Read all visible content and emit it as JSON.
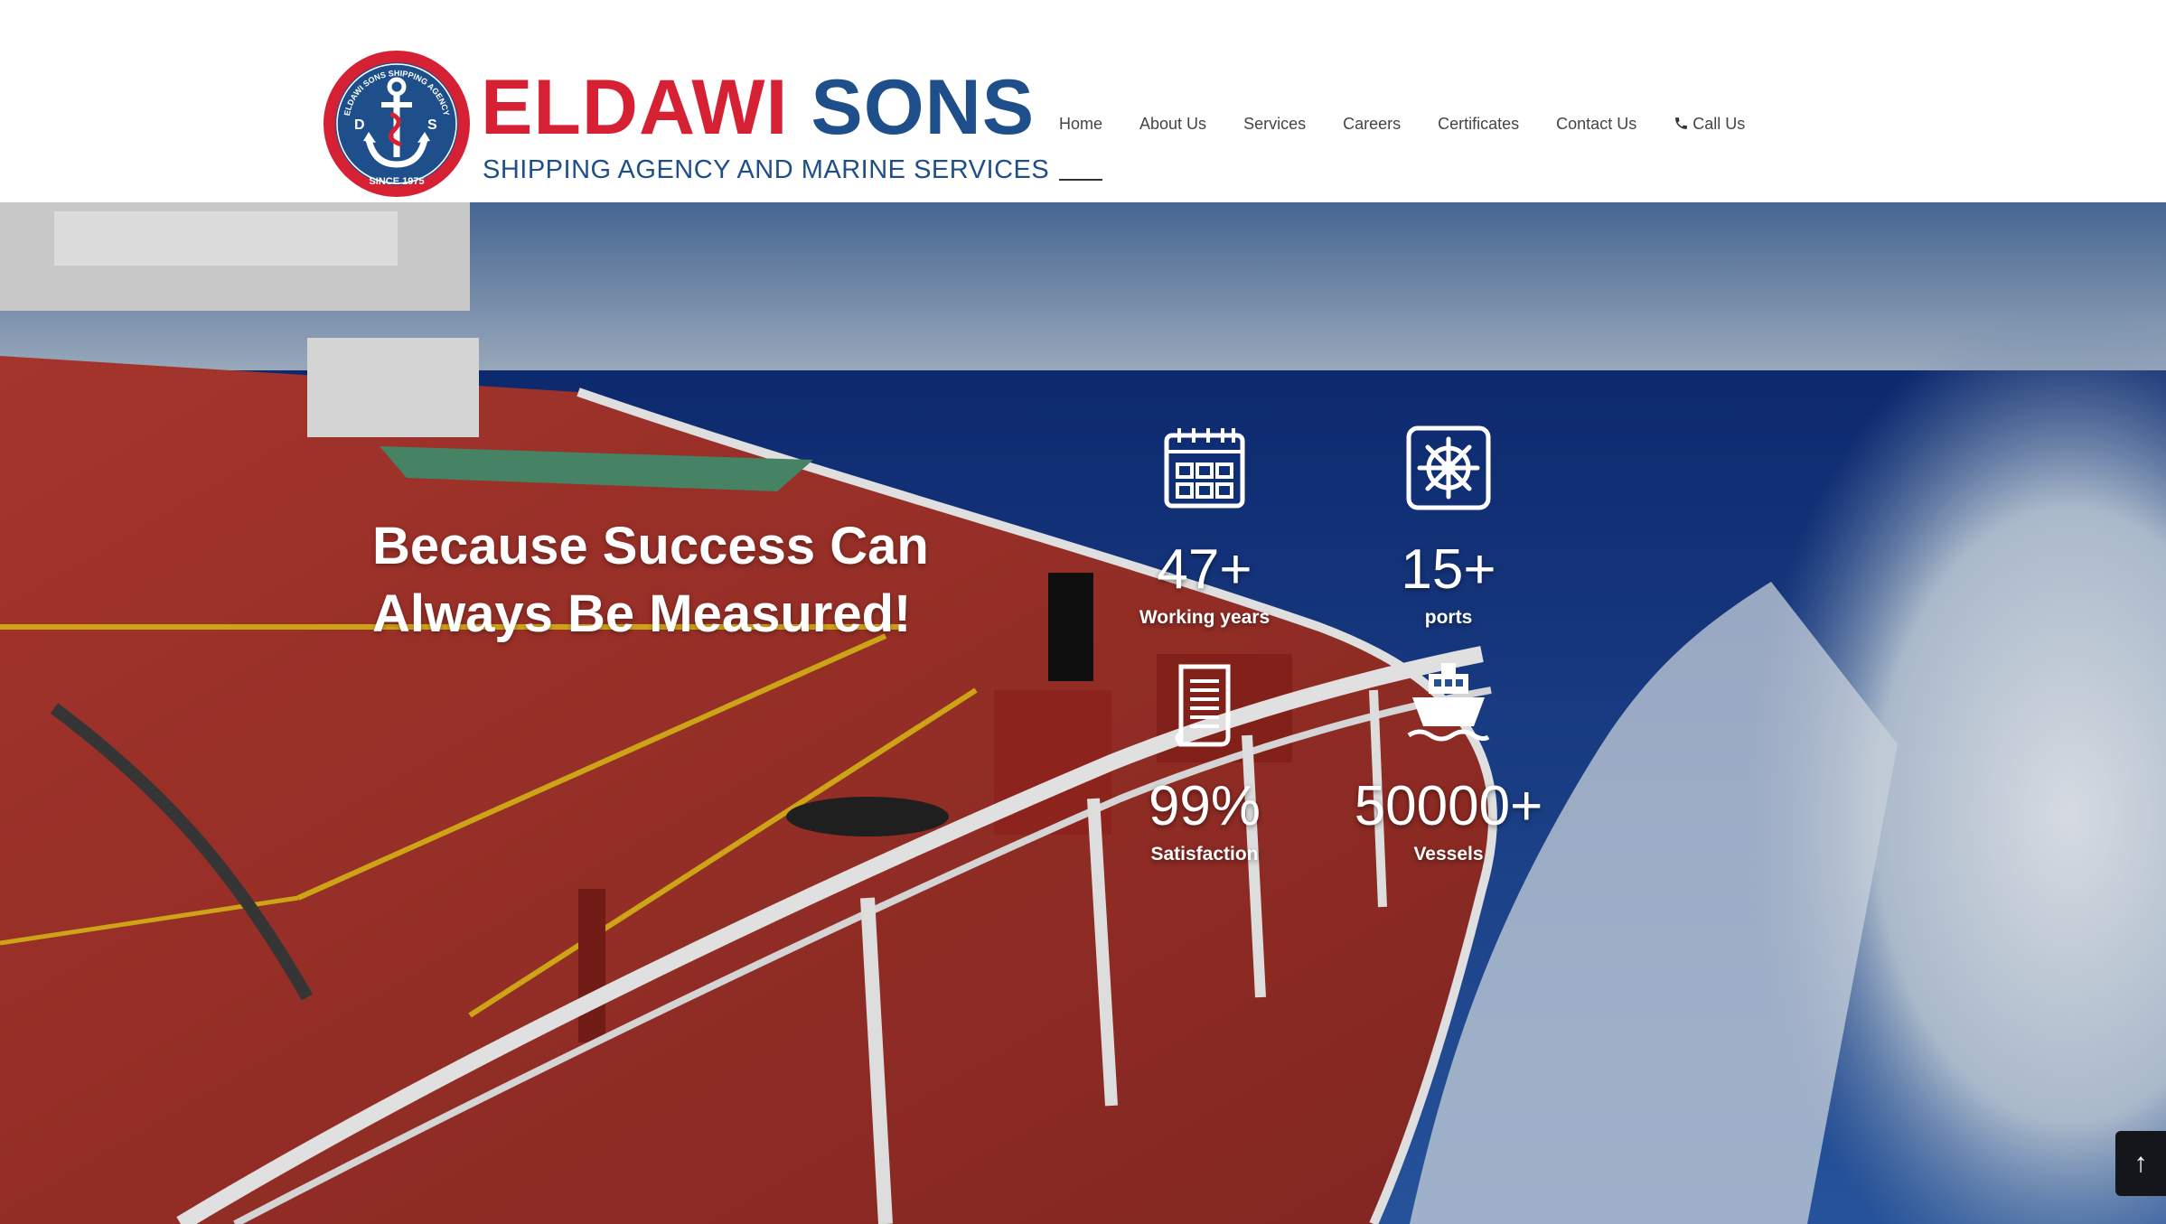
{
  "brand": {
    "name_part1": "ELDAWI",
    "name_part2": "SONS",
    "tagline": "SHIPPING AGENCY AND MARINE SERVICES",
    "badge_text_top": "ELDAWI SONS SHIPPING AGENCY",
    "badge_text_bottom": "SINCE 1975",
    "badge_letter_left": "D",
    "badge_letter_right": "S"
  },
  "nav": {
    "items": [
      {
        "label": "Home",
        "active": true
      },
      {
        "label": "About Us"
      },
      {
        "label": "Services"
      },
      {
        "label": "Careers"
      },
      {
        "label": "Certificates"
      },
      {
        "label": "Contact Us"
      },
      {
        "label": "Call Us",
        "icon": "phone-icon"
      }
    ]
  },
  "hero": {
    "heading_line1": "Because Success Can",
    "heading_line2": "Always Be Measured!"
  },
  "stats": [
    {
      "value": "47+",
      "label": "Working years",
      "icon": "calendar-icon"
    },
    {
      "value": "15+",
      "label": "ports",
      "icon": "ship-wheel-icon"
    },
    {
      "value": "99%",
      "label": "Satisfaction",
      "icon": "document-icon"
    },
    {
      "value": "50000+",
      "label": "Vessels",
      "icon": "ship-icon"
    }
  ],
  "back_to_top": {
    "symbol": "↑",
    "icon": "arrow-up-icon"
  },
  "colors": {
    "brand_red": "#d62135",
    "brand_blue": "#1f4f8a",
    "deck_red": "#a8322a",
    "sea_blue": "#1d3f8a"
  }
}
